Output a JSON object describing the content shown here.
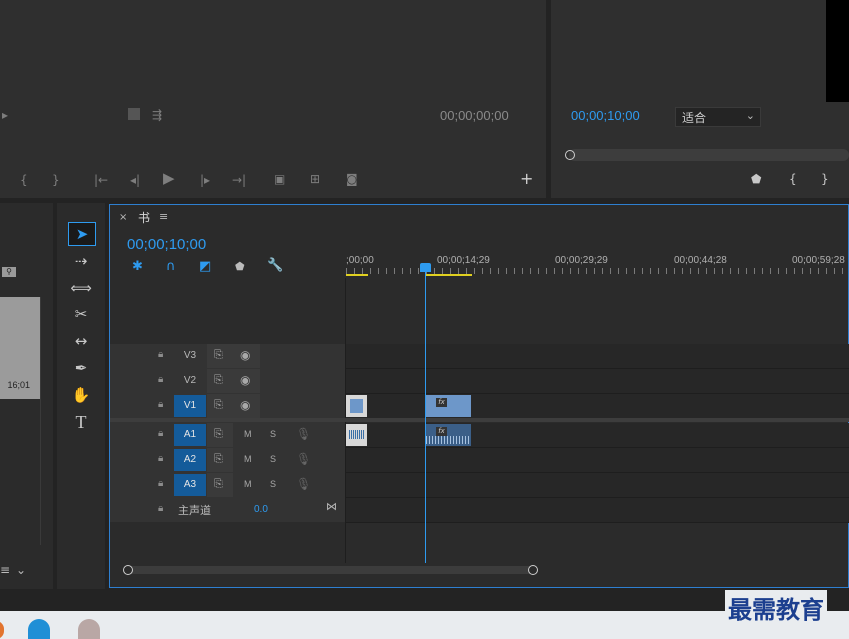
{
  "source_monitor": {
    "timecode": "00;00;00;00"
  },
  "program_monitor": {
    "timecode": "00;00;10;00",
    "fit_label": "适合"
  },
  "project_panel": {
    "thumb_duration": "16;01"
  },
  "timeline": {
    "tab_label": "书",
    "timecode": "00;00;10;00",
    "ruler_labels": [
      ";00;00",
      "00;00;14;29",
      "00;00;29;29",
      "00;00;44;28",
      "00;00;59;28"
    ],
    "video_tracks": [
      "V3",
      "V2",
      "V1"
    ],
    "audio_tracks": [
      "A1",
      "A2",
      "A3"
    ],
    "mute_label": "M",
    "solo_label": "S",
    "master_label": "主声道",
    "master_value": "0.0",
    "clip_fx_label": "fx"
  },
  "watermark": "最需教育",
  "colors": {
    "accent": "#2e9bf0",
    "selected_track": "#145b9a",
    "clip": "#6d97c9",
    "work_area": "#e0d020"
  }
}
